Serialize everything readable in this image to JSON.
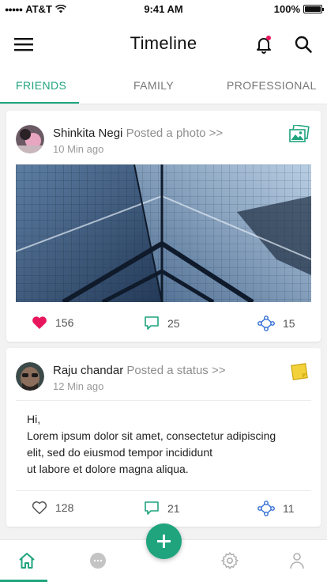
{
  "status_bar": {
    "carrier": "AT&T",
    "time": "9:41 AM",
    "battery": "100%"
  },
  "header": {
    "title": "Timeline",
    "icons": [
      "menu-icon",
      "notification-bell-icon",
      "search-icon"
    ],
    "notification_dot_color": "#e8175d"
  },
  "tabs": [
    {
      "label": "FRIENDS",
      "active": true
    },
    {
      "label": "FAMILY",
      "active": false
    },
    {
      "label": "PROFESSIONAL",
      "active": false
    }
  ],
  "accent_color": "#1fa47e",
  "posts": [
    {
      "author": "Shinkita Negi",
      "action": "Posted a photo >>",
      "time": "10 Min ago",
      "type_icon": "photo-icon",
      "likes": "156",
      "liked": true,
      "comments": "25",
      "shares": "15"
    },
    {
      "author": "Raju chandar",
      "action": "Posted a status >>",
      "time": "12 Min ago",
      "type_icon": "note-icon",
      "text_lines": [
        "Hi,",
        "Lorem ipsum dolor sit amet, consectetur adipiscing",
        "elit, sed do eiusmod tempor incididunt",
        "ut labore et dolore magna aliqua."
      ],
      "likes": "128",
      "liked": false,
      "comments": "21",
      "shares": "11"
    }
  ],
  "bottom_nav": {
    "items": [
      "home-icon",
      "chat-icon",
      "settings-icon",
      "profile-icon"
    ],
    "active": "home-icon",
    "fab_icon": "plus-icon"
  }
}
